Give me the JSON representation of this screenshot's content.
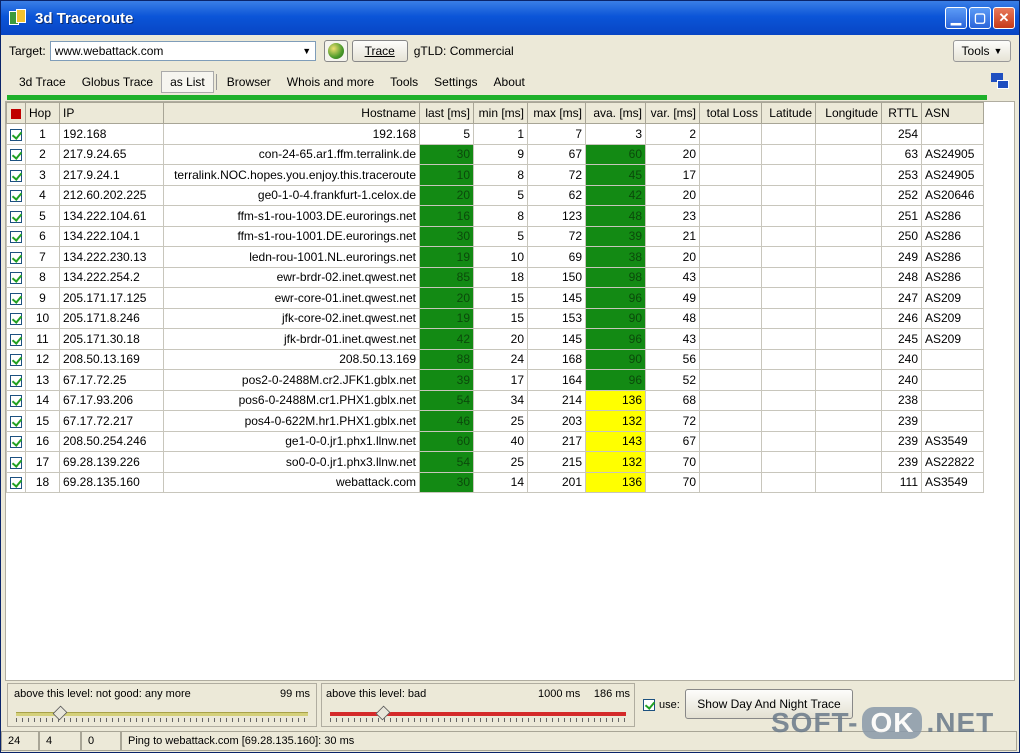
{
  "window": {
    "title": "3d Traceroute"
  },
  "toolbar": {
    "target_label": "Target:",
    "target_value": "www.webattack.com",
    "trace_label": "Trace",
    "gtld_text": "gTLD: Commercial",
    "tools_label": "Tools"
  },
  "menu": {
    "items": [
      "3d Trace",
      "Globus Trace",
      "as List",
      "Browser",
      "Whois and more",
      "Tools",
      "Settings",
      "About"
    ]
  },
  "grid": {
    "columns": [
      "Hop",
      "IP",
      "Hostname",
      "last [ms]",
      "min [ms]",
      "max [ms]",
      "ava. [ms]",
      "var. [ms]",
      "total Loss",
      "Latitude",
      "Longitude",
      "RTTL",
      "ASN"
    ],
    "rows": [
      {
        "hop": "1",
        "ip": "192.168",
        "host": "192.168",
        "last": "5",
        "min": "1",
        "max": "7",
        "ava": "3",
        "var": "2",
        "loss": "",
        "lat": "",
        "lon": "",
        "rttl": "254",
        "asn": "",
        "last_c": "",
        "ava_c": ""
      },
      {
        "hop": "2",
        "ip": "217.9.24.65",
        "host": "con-24-65.ar1.ffm.terralink.de",
        "last": "30",
        "min": "9",
        "max": "67",
        "ava": "60",
        "var": "20",
        "loss": "",
        "lat": "",
        "lon": "",
        "rttl": "63",
        "asn": "AS24905",
        "last_c": "g",
        "ava_c": "g"
      },
      {
        "hop": "3",
        "ip": "217.9.24.1",
        "host": "terralink.NOC.hopes.you.enjoy.this.traceroute",
        "last": "10",
        "min": "8",
        "max": "72",
        "ava": "45",
        "var": "17",
        "loss": "",
        "lat": "",
        "lon": "",
        "rttl": "253",
        "asn": "AS24905",
        "last_c": "g",
        "ava_c": "g"
      },
      {
        "hop": "4",
        "ip": "212.60.202.225",
        "host": "ge0-1-0-4.frankfurt-1.celox.de",
        "last": "20",
        "min": "5",
        "max": "62",
        "ava": "42",
        "var": "20",
        "loss": "",
        "lat": "",
        "lon": "",
        "rttl": "252",
        "asn": "AS20646",
        "last_c": "g",
        "ava_c": "g"
      },
      {
        "hop": "5",
        "ip": "134.222.104.61",
        "host": "ffm-s1-rou-1003.DE.eurorings.net",
        "last": "16",
        "min": "8",
        "max": "123",
        "ava": "48",
        "var": "23",
        "loss": "",
        "lat": "",
        "lon": "",
        "rttl": "251",
        "asn": "AS286",
        "last_c": "g",
        "ava_c": "g"
      },
      {
        "hop": "6",
        "ip": "134.222.104.1",
        "host": "ffm-s1-rou-1001.DE.eurorings.net",
        "last": "30",
        "min": "5",
        "max": "72",
        "ava": "39",
        "var": "21",
        "loss": "",
        "lat": "",
        "lon": "",
        "rttl": "250",
        "asn": "AS286",
        "last_c": "g",
        "ava_c": "g"
      },
      {
        "hop": "7",
        "ip": "134.222.230.13",
        "host": "ledn-rou-1001.NL.eurorings.net",
        "last": "19",
        "min": "10",
        "max": "69",
        "ava": "38",
        "var": "20",
        "loss": "",
        "lat": "",
        "lon": "",
        "rttl": "249",
        "asn": "AS286",
        "last_c": "g",
        "ava_c": "g"
      },
      {
        "hop": "8",
        "ip": "134.222.254.2",
        "host": "ewr-brdr-02.inet.qwest.net",
        "last": "85",
        "min": "18",
        "max": "150",
        "ava": "98",
        "var": "43",
        "loss": "",
        "lat": "",
        "lon": "",
        "rttl": "248",
        "asn": "AS286",
        "last_c": "g",
        "ava_c": "g"
      },
      {
        "hop": "9",
        "ip": "205.171.17.125",
        "host": "ewr-core-01.inet.qwest.net",
        "last": "20",
        "min": "15",
        "max": "145",
        "ava": "96",
        "var": "49",
        "loss": "",
        "lat": "",
        "lon": "",
        "rttl": "247",
        "asn": "AS209",
        "last_c": "g",
        "ava_c": "g"
      },
      {
        "hop": "10",
        "ip": "205.171.8.246",
        "host": "jfk-core-02.inet.qwest.net",
        "last": "19",
        "min": "15",
        "max": "153",
        "ava": "90",
        "var": "48",
        "loss": "",
        "lat": "",
        "lon": "",
        "rttl": "246",
        "asn": "AS209",
        "last_c": "g",
        "ava_c": "g"
      },
      {
        "hop": "11",
        "ip": "205.171.30.18",
        "host": "jfk-brdr-01.inet.qwest.net",
        "last": "42",
        "min": "20",
        "max": "145",
        "ava": "96",
        "var": "43",
        "loss": "",
        "lat": "",
        "lon": "",
        "rttl": "245",
        "asn": "AS209",
        "last_c": "g",
        "ava_c": "g"
      },
      {
        "hop": "12",
        "ip": "208.50.13.169",
        "host": "208.50.13.169",
        "last": "88",
        "min": "24",
        "max": "168",
        "ava": "90",
        "var": "56",
        "loss": "",
        "lat": "",
        "lon": "",
        "rttl": "240",
        "asn": "",
        "last_c": "g",
        "ava_c": "g"
      },
      {
        "hop": "13",
        "ip": "67.17.72.25",
        "host": "pos2-0-2488M.cr2.JFK1.gblx.net",
        "last": "39",
        "min": "17",
        "max": "164",
        "ava": "96",
        "var": "52",
        "loss": "",
        "lat": "",
        "lon": "",
        "rttl": "240",
        "asn": "",
        "last_c": "g",
        "ava_c": "g"
      },
      {
        "hop": "14",
        "ip": "67.17.93.206",
        "host": "pos6-0-2488M.cr1.PHX1.gblx.net",
        "last": "54",
        "min": "34",
        "max": "214",
        "ava": "136",
        "var": "68",
        "loss": "",
        "lat": "",
        "lon": "",
        "rttl": "238",
        "asn": "",
        "last_c": "g",
        "ava_c": "y"
      },
      {
        "hop": "15",
        "ip": "67.17.72.217",
        "host": "pos4-0-622M.hr1.PHX1.gblx.net",
        "last": "46",
        "min": "25",
        "max": "203",
        "ava": "132",
        "var": "72",
        "loss": "",
        "lat": "",
        "lon": "",
        "rttl": "239",
        "asn": "",
        "last_c": "g",
        "ava_c": "y"
      },
      {
        "hop": "16",
        "ip": "208.50.254.246",
        "host": "ge1-0-0.jr1.phx1.llnw.net",
        "last": "60",
        "min": "40",
        "max": "217",
        "ava": "143",
        "var": "67",
        "loss": "",
        "lat": "",
        "lon": "",
        "rttl": "239",
        "asn": "AS3549",
        "last_c": "g",
        "ava_c": "y"
      },
      {
        "hop": "17",
        "ip": "69.28.139.226",
        "host": "so0-0-0.jr1.phx3.llnw.net",
        "last": "54",
        "min": "25",
        "max": "215",
        "ava": "132",
        "var": "70",
        "loss": "",
        "lat": "",
        "lon": "",
        "rttl": "239",
        "asn": "AS22822",
        "last_c": "g",
        "ava_c": "y"
      },
      {
        "hop": "18",
        "ip": "69.28.135.160",
        "host": "webattack.com",
        "last": "30",
        "min": "14",
        "max": "201",
        "ava": "136",
        "var": "70",
        "loss": "",
        "lat": "",
        "lon": "",
        "rttl": "111",
        "asn": "AS3549",
        "last_c": "g",
        "ava_c": "y"
      }
    ]
  },
  "levels": {
    "good_label": "above this level: not good: any more",
    "good_value": "99 ms",
    "bad_label": "above this level: bad",
    "bad_value_1": "1000 ms",
    "bad_value_2": "186 ms",
    "good_level": 0.15,
    "bad_level": 0.18,
    "use_label": "use:",
    "day_night_label": "Show Day And Night Trace"
  },
  "statusbar": {
    "cell1": "24",
    "cell2": "4",
    "cell3": "0",
    "message": "Ping to webattack.com [69.28.135.160]: 30 ms"
  },
  "watermark": {
    "part1": "SOFT-",
    "part2": "OK",
    "part3": ".NET"
  },
  "colors": {
    "good": "#138a14",
    "warn": "#ffff00",
    "title": "#0b55d8"
  }
}
